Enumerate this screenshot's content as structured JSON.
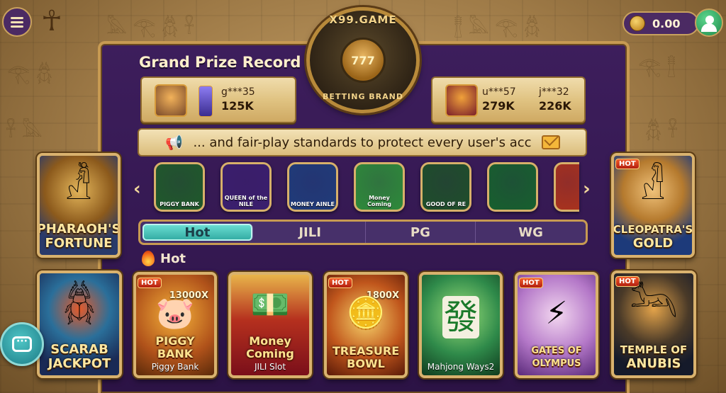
{
  "header": {
    "balance": "0.00",
    "icons": {
      "menu": "hamburger-icon",
      "ankh": "ankh-icon",
      "coin": "scarab-coin-icon",
      "user": "user-icon"
    }
  },
  "logo": {
    "top_text": "X99.GAME",
    "bottom_text": "BETTING BRAND",
    "reels": "777"
  },
  "prize_record": {
    "title": "Grand Prize Record",
    "left": [
      {
        "name": "g***35",
        "amount": "125K"
      }
    ],
    "right": [
      {
        "name": "u***57",
        "amount": "279K"
      },
      {
        "name": "j***32",
        "amount": "226K"
      }
    ]
  },
  "marquee": {
    "text": "... and fair-play standards to protect every user's acc"
  },
  "carousel": {
    "items": [
      {
        "label": "PIGGY BANK",
        "color": "#1f5a2a"
      },
      {
        "label": "QUEEN of the NILE",
        "color": "#3a1f6e"
      },
      {
        "label": "MONEY AINLE",
        "color": "#1f3c7a"
      },
      {
        "label": "Money Coming",
        "color": "#2e8a3a"
      },
      {
        "label": "GOOD OF RE",
        "color": "#1e4f2a"
      },
      {
        "label": "",
        "color": "#17602e"
      },
      {
        "label": "",
        "color": "#a8321e"
      }
    ]
  },
  "heroes": {
    "pharaoh": {
      "title_line1": "PHARAOH'S",
      "title_line2": "FORTUNE"
    },
    "cleopatra": {
      "title_line1": "CLEOPATRA'S",
      "title_line2": "GOLD",
      "badge": "HOT"
    },
    "scarab": {
      "title_line1": "SCARAB",
      "title_line2": "JACKPOT"
    },
    "anubis": {
      "title_line1": "TEMPLE OF",
      "title_line2": "ANUBIS",
      "badge": "HOT"
    }
  },
  "tabs": [
    {
      "label": "Hot",
      "active": true
    },
    {
      "label": "JILI",
      "active": false
    },
    {
      "label": "PG",
      "active": false
    },
    {
      "label": "WG",
      "active": false
    }
  ],
  "section": {
    "label": "Hot"
  },
  "games": [
    {
      "title": "PIGGY BANK",
      "subtitle": "Piggy Bank",
      "badge": "HOT",
      "multiplier": "13000X",
      "bg": "#c8781c"
    },
    {
      "title": "Money Coming",
      "subtitle": "JILI Slot",
      "badge": "",
      "multiplier": "",
      "bg": "#b21e2e"
    },
    {
      "title": "TREASURE BOWL",
      "subtitle": "",
      "badge": "HOT",
      "multiplier": "1800X",
      "bg": "#b5461a"
    },
    {
      "title": "",
      "subtitle": "Mahjong Ways2",
      "badge": "",
      "multiplier": "",
      "bg": "#2f8a4a"
    },
    {
      "title": "GATES OF OLYMPUS",
      "subtitle": "",
      "badge": "HOT",
      "multiplier": "",
      "bg": "#b478c8"
    }
  ],
  "colors": {
    "panel": "#3d1e5c",
    "gold_border": "#c79a52",
    "active_tab": "#2fa8a0"
  }
}
